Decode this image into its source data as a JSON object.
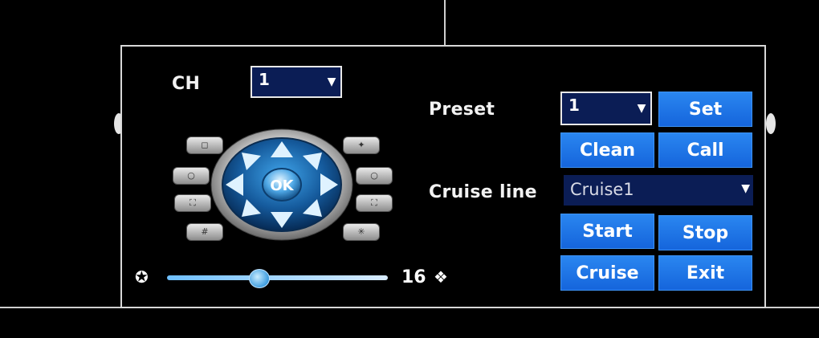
{
  "ch": {
    "label": "CH",
    "value": "1"
  },
  "preset": {
    "label": "Preset",
    "value": "1"
  },
  "cruise_line": {
    "label": "Cruise line",
    "value": "Cruise1"
  },
  "buttons": {
    "set": "Set",
    "clean": "Clean",
    "call": "Call",
    "start": "Start",
    "stop": "Stop",
    "cruise": "Cruise",
    "exit": "Exit"
  },
  "dpad": {
    "center_label": "OK"
  },
  "speed": {
    "value": "16",
    "level": 0.44
  },
  "icons": {
    "dropdown": "chevron-down-icon",
    "slow": "walking-person-icon",
    "fast": "running-person-icon"
  },
  "colors": {
    "button": "#1f78e8",
    "select": "#0b1d55",
    "accent": "#2a86f0"
  }
}
